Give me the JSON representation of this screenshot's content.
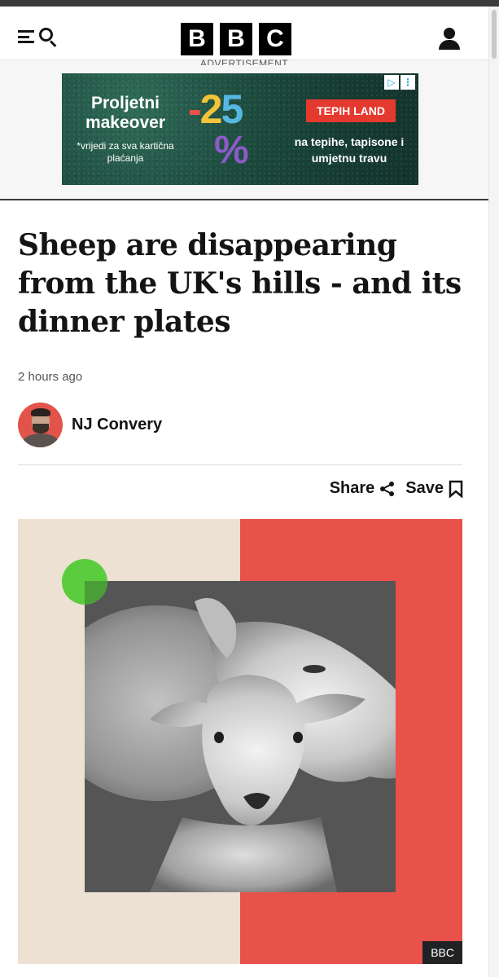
{
  "header": {
    "logo_letters": [
      "B",
      "B",
      "C"
    ],
    "menu_icon": "menu-icon",
    "search_icon": "search-icon",
    "account_icon": "account-icon"
  },
  "ad": {
    "label": "ADVERTISEMENT",
    "title": "Proljetni makeover",
    "note": "*vrijedi za sva kartična plaćanja",
    "discount_number": "-25",
    "discount_percent": "%",
    "brand": "TEPIH LAND",
    "tagline": "na tepihe, tapisone i umjetnu travu",
    "choices_icons": [
      "adchoices-icon",
      "ad-more-icon"
    ]
  },
  "article": {
    "headline": "Sheep are disappearing from the UK's hills - and its dinner plates",
    "timestamp": "2 hours ago",
    "author": "NJ Convery",
    "share_label": "Share",
    "save_label": "Save",
    "image_credit": "BBC"
  },
  "colors": {
    "brand_black": "#000000",
    "hero_red": "#e8524a",
    "hero_beige": "#ede1d4",
    "hero_green": "#5ccc3f",
    "ad_green": "#1d4b3e",
    "ad_brand_red": "#e4392f"
  }
}
